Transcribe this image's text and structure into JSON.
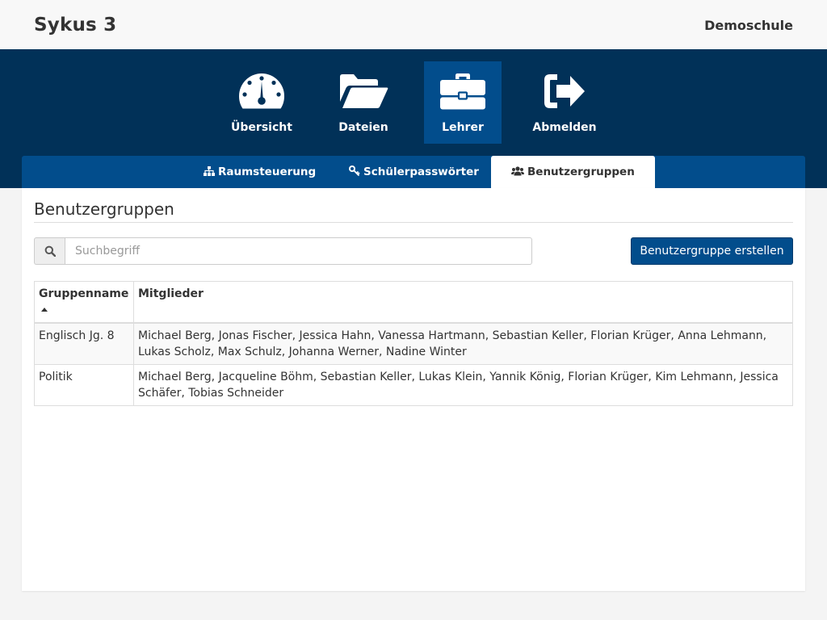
{
  "app": {
    "title": "Sykus 3",
    "school": "Demoschule"
  },
  "main_nav": [
    {
      "label": "Übersicht",
      "icon": "dashboard-icon",
      "active": false
    },
    {
      "label": "Dateien",
      "icon": "folder-open-icon",
      "active": false
    },
    {
      "label": "Lehrer",
      "icon": "briefcase-icon",
      "active": true
    },
    {
      "label": "Abmelden",
      "icon": "sign-out-icon",
      "active": false
    }
  ],
  "sub_nav": [
    {
      "label": "Raumsteuerung",
      "icon": "sitemap-icon",
      "active": false
    },
    {
      "label": "Schülerpasswörter",
      "icon": "key-icon",
      "active": false
    },
    {
      "label": "Benutzergruppen",
      "icon": "users-icon",
      "active": true
    }
  ],
  "page": {
    "title": "Benutzergruppen"
  },
  "search": {
    "placeholder": "Suchbegriff",
    "value": "",
    "icon": "search-icon"
  },
  "create_button": {
    "label": "Benutzergruppe erstellen"
  },
  "table": {
    "columns": [
      "Gruppenname",
      "Mitglieder"
    ],
    "sort": {
      "column": "Gruppenname",
      "direction": "ascending"
    },
    "rows": [
      {
        "name": "Englisch Jg. 8",
        "members": "Michael Berg, Jonas Fischer, Jessica Hahn, Vanessa Hartmann, Sebastian Keller, Florian Krüger, Anna Lehmann, Lukas Scholz, Max Schulz, Johanna Werner, Nadine Winter"
      },
      {
        "name": "Politik",
        "members": "Michael Berg, Jacqueline Böhm, Sebastian Keller, Lukas Klein, Yannik König, Florian Krüger, Kim Lehmann, Jessica Schäfer, Tobias Schneider"
      }
    ]
  },
  "colors": {
    "nav_background": "#013158",
    "active_accent": "#024d8c"
  }
}
